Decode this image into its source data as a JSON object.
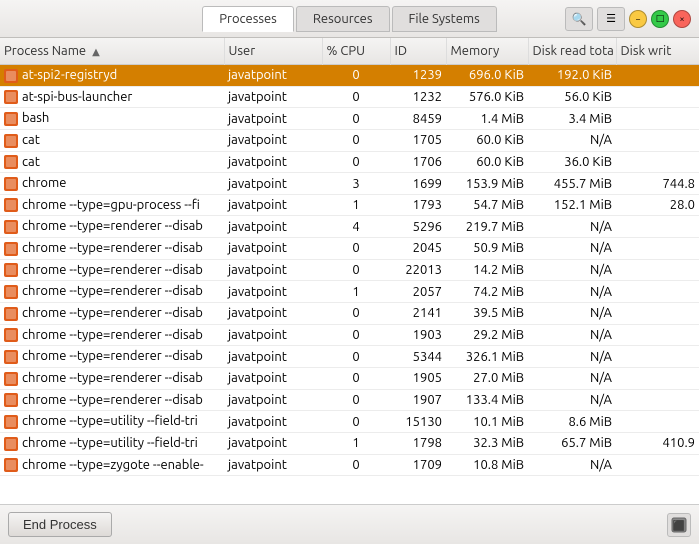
{
  "titlebar": {
    "tabs": [
      {
        "label": "Processes",
        "active": true
      },
      {
        "label": "Resources",
        "active": false
      },
      {
        "label": "File Systems",
        "active": false
      }
    ],
    "search_icon": "🔍",
    "menu_icon": "☰",
    "win_min": "−",
    "win_max": "□",
    "win_close": "×"
  },
  "table": {
    "columns": [
      {
        "label": "Process Name",
        "class": "col-name",
        "sort_arrow": "▲"
      },
      {
        "label": "User",
        "class": "col-user"
      },
      {
        "label": "% CPU",
        "class": "col-cpu"
      },
      {
        "label": "ID",
        "class": "col-id"
      },
      {
        "label": "Memory",
        "class": "col-mem"
      },
      {
        "label": "Disk read tota",
        "class": "col-dread"
      },
      {
        "label": "Disk writ",
        "class": "col-dwrite"
      }
    ],
    "rows": [
      {
        "name": "at-spi2-registryd",
        "user": "javatpoint",
        "cpu": "0",
        "id": "1239",
        "mem": "696.0 KiB",
        "dread": "192.0 KiB",
        "dwrite": "",
        "selected": true
      },
      {
        "name": "at-spi-bus-launcher",
        "user": "javatpoint",
        "cpu": "0",
        "id": "1232",
        "mem": "576.0 KiB",
        "dread": "56.0 KiB",
        "dwrite": ""
      },
      {
        "name": "bash",
        "user": "javatpoint",
        "cpu": "0",
        "id": "8459",
        "mem": "1.4 MiB",
        "dread": "3.4 MiB",
        "dwrite": ""
      },
      {
        "name": "cat",
        "user": "javatpoint",
        "cpu": "0",
        "id": "1705",
        "mem": "60.0 KiB",
        "dread": "N/A",
        "dwrite": ""
      },
      {
        "name": "cat",
        "user": "javatpoint",
        "cpu": "0",
        "id": "1706",
        "mem": "60.0 KiB",
        "dread": "36.0 KiB",
        "dwrite": ""
      },
      {
        "name": "chrome",
        "user": "javatpoint",
        "cpu": "3",
        "id": "1699",
        "mem": "153.9 MiB",
        "dread": "455.7 MiB",
        "dwrite": "744.8"
      },
      {
        "name": "chrome --type=gpu-process --fi",
        "user": "javatpoint",
        "cpu": "1",
        "id": "1793",
        "mem": "54.7 MiB",
        "dread": "152.1 MiB",
        "dwrite": "28.0"
      },
      {
        "name": "chrome --type=renderer --disab",
        "user": "javatpoint",
        "cpu": "4",
        "id": "5296",
        "mem": "219.7 MiB",
        "dread": "N/A",
        "dwrite": ""
      },
      {
        "name": "chrome --type=renderer --disab",
        "user": "javatpoint",
        "cpu": "0",
        "id": "2045",
        "mem": "50.9 MiB",
        "dread": "N/A",
        "dwrite": ""
      },
      {
        "name": "chrome --type=renderer --disab",
        "user": "javatpoint",
        "cpu": "0",
        "id": "22013",
        "mem": "14.2 MiB",
        "dread": "N/A",
        "dwrite": ""
      },
      {
        "name": "chrome --type=renderer --disab",
        "user": "javatpoint",
        "cpu": "1",
        "id": "2057",
        "mem": "74.2 MiB",
        "dread": "N/A",
        "dwrite": ""
      },
      {
        "name": "chrome --type=renderer --disab",
        "user": "javatpoint",
        "cpu": "0",
        "id": "2141",
        "mem": "39.5 MiB",
        "dread": "N/A",
        "dwrite": ""
      },
      {
        "name": "chrome --type=renderer --disab",
        "user": "javatpoint",
        "cpu": "0",
        "id": "1903",
        "mem": "29.2 MiB",
        "dread": "N/A",
        "dwrite": ""
      },
      {
        "name": "chrome --type=renderer --disab",
        "user": "javatpoint",
        "cpu": "0",
        "id": "5344",
        "mem": "326.1 MiB",
        "dread": "N/A",
        "dwrite": ""
      },
      {
        "name": "chrome --type=renderer --disab",
        "user": "javatpoint",
        "cpu": "0",
        "id": "1905",
        "mem": "27.0 MiB",
        "dread": "N/A",
        "dwrite": ""
      },
      {
        "name": "chrome --type=renderer --disab",
        "user": "javatpoint",
        "cpu": "0",
        "id": "1907",
        "mem": "133.4 MiB",
        "dread": "N/A",
        "dwrite": ""
      },
      {
        "name": "chrome --type=utility --field-tri",
        "user": "javatpoint",
        "cpu": "0",
        "id": "15130",
        "mem": "10.1 MiB",
        "dread": "8.6 MiB",
        "dwrite": ""
      },
      {
        "name": "chrome --type=utility --field-tri",
        "user": "javatpoint",
        "cpu": "1",
        "id": "1798",
        "mem": "32.3 MiB",
        "dread": "65.7 MiB",
        "dwrite": "410.9"
      },
      {
        "name": "chrome --type=zygote --enable-",
        "user": "javatpoint",
        "cpu": "0",
        "id": "1709",
        "mem": "10.8 MiB",
        "dread": "N/A",
        "dwrite": ""
      }
    ]
  },
  "bottombar": {
    "end_process_label": "End Process",
    "info_icon": "⬛"
  }
}
